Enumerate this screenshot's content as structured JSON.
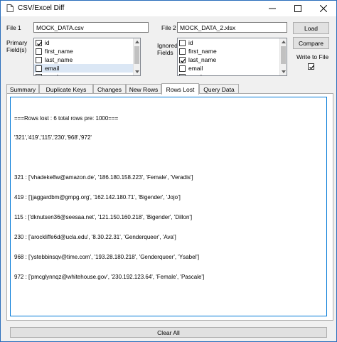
{
  "window": {
    "title": "CSV/Excel Diff",
    "controls": [
      "minimize-icon",
      "maximize-icon",
      "close-icon"
    ]
  },
  "file1": {
    "label": "File 1",
    "value": "MOCK_DATA.csv"
  },
  "file2": {
    "label": "File 2",
    "value": "MOCK_DATA_2.xlsx"
  },
  "buttons": {
    "load": "Load",
    "compare": "Compare",
    "clear_all": "Clear All"
  },
  "primary_fields": {
    "label": "Primary Field(s)",
    "items": [
      {
        "label": "id",
        "checked": true,
        "selected": false
      },
      {
        "label": "first_name",
        "checked": false,
        "selected": false
      },
      {
        "label": "last_name",
        "checked": false,
        "selected": false
      },
      {
        "label": "email",
        "checked": false,
        "selected": true
      },
      {
        "label": "gender",
        "checked": false,
        "selected": false
      }
    ]
  },
  "ignored_fields": {
    "label": "Ignored Fields",
    "items": [
      {
        "label": "id",
        "checked": false,
        "selected": false
      },
      {
        "label": "first_name",
        "checked": false,
        "selected": false
      },
      {
        "label": "last_name",
        "checked": true,
        "selected": false
      },
      {
        "label": "email",
        "checked": false,
        "selected": false
      },
      {
        "label": "gender",
        "checked": false,
        "selected": false
      }
    ]
  },
  "write_to_file": {
    "label": "Write to File",
    "checked": true
  },
  "tabs": [
    {
      "label": "Summary",
      "active": false
    },
    {
      "label": "Duplicate Keys",
      "active": false
    },
    {
      "label": "Changes",
      "active": false
    },
    {
      "label": "New Rows",
      "active": false
    },
    {
      "label": "Rows Lost",
      "active": true
    },
    {
      "label": "Query Data",
      "active": false
    }
  ],
  "output": {
    "lines": [
      "===Rows lost : 6 total rows pre: 1000===",
      "'321','419','115','230','968','972'",
      "",
      "321 : ['vhadeke8w@amazon.de', '186.180.158.223', 'Female', 'Veradis']",
      "419 : ['jjaggardbm@gmpg.org', '162.142.180.71', 'Bigender', 'Jojo']",
      "115 : ['dknutsen36@seesaa.net', '121.150.160.218', 'Bigender', 'Dillon']",
      "230 : ['arockliffe6d@ucla.edu', '8.30.22.31', 'Genderqueer', 'Ava']",
      "968 : ['ystebbinsqv@time.com', '193.28.180.218', 'Genderqueer', 'Ysabel']",
      "972 : ['pmcglynnqz@whitehouse.gov', '230.192.123.64', 'Female', 'Pascale']"
    ]
  }
}
